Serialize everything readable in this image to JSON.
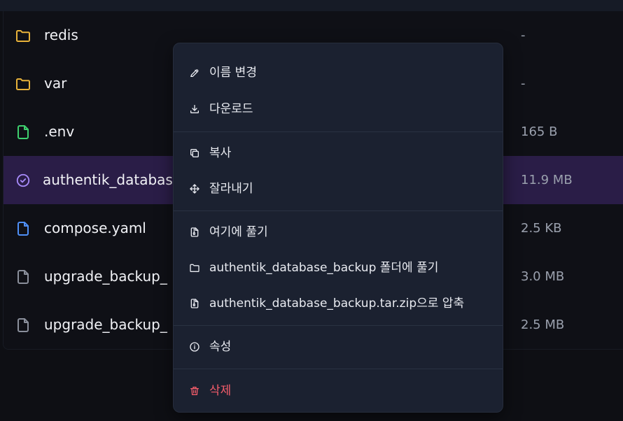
{
  "files": [
    {
      "name": "redis",
      "size": "-",
      "icon": "folder-icon",
      "color": "#e8b23a"
    },
    {
      "name": "var",
      "size": "-",
      "icon": "folder-icon",
      "color": "#e8b23a"
    },
    {
      "name": ".env",
      "size": "165 B",
      "icon": "file-icon",
      "color": "#3ecf6e"
    },
    {
      "name": "authentik_databas",
      "size": "11.9 MB",
      "icon": "check-circle-icon",
      "color": "#a78bfa",
      "selected": true
    },
    {
      "name": "compose.yaml",
      "size": "2.5 KB",
      "icon": "file-icon",
      "color": "#4f8ff7"
    },
    {
      "name": "upgrade_backup_",
      "size": "3.0 MB",
      "icon": "file-icon",
      "color": "#8a8f9b"
    },
    {
      "name": "upgrade_backup_",
      "size": "2.5 MB",
      "icon": "file-icon",
      "color": "#8a8f9b"
    }
  ],
  "context_menu": {
    "items": [
      {
        "label": "이름 변경",
        "icon": "pencil-icon"
      },
      {
        "label": "다운로드",
        "icon": "download-icon"
      },
      {
        "label": "복사",
        "icon": "copy-icon"
      },
      {
        "label": "잘라내기",
        "icon": "move-icon"
      },
      {
        "label": "여기에 풀기",
        "icon": "archive-file-icon"
      },
      {
        "label": "authentik_database_backup 폴더에 풀기",
        "icon": "folder-outline-icon"
      },
      {
        "label": "authentik_database_backup.tar.zip으로 압축",
        "icon": "archive-file-icon"
      },
      {
        "label": "속성",
        "icon": "info-icon"
      },
      {
        "label": "삭제",
        "icon": "trash-icon",
        "danger": true
      }
    ]
  },
  "colors": {
    "background": "#0e0f14",
    "menu_background": "#1b2130",
    "selected_row": "#2a1d47",
    "danger": "#f25c6a"
  }
}
